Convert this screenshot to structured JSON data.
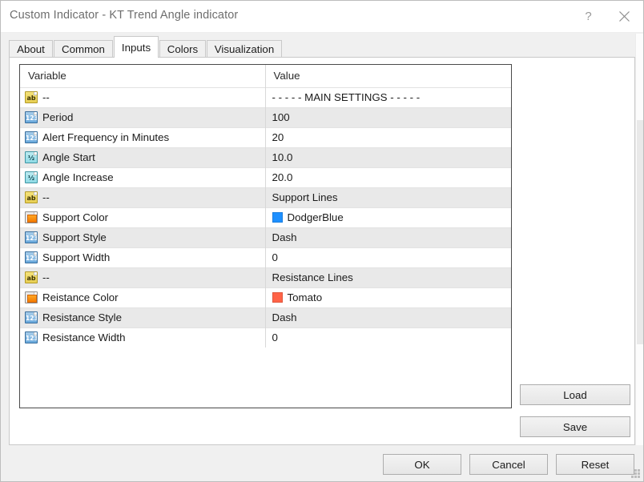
{
  "window": {
    "title": "Custom Indicator - KT Trend Angle indicator",
    "help_icon": "help-question-icon",
    "help_glyph": "?",
    "close_icon": "close-x-icon"
  },
  "tabs": [
    {
      "label": "About",
      "active": false
    },
    {
      "label": "Common",
      "active": false
    },
    {
      "label": "Inputs",
      "active": true
    },
    {
      "label": "Colors",
      "active": false
    },
    {
      "label": "Visualization",
      "active": false
    }
  ],
  "table": {
    "headers": {
      "variable": "Variable",
      "value": "Value"
    },
    "rows": [
      {
        "icon": "string-type-icon",
        "type": "str",
        "variable": "--",
        "value": "- - - - - MAIN SETTINGS - - - - -",
        "shade": "norm"
      },
      {
        "icon": "integer-type-icon",
        "type": "int",
        "variable": "Period",
        "value": "100",
        "shade": "alt"
      },
      {
        "icon": "integer-type-icon",
        "type": "int",
        "variable": "Alert Frequency in Minutes",
        "value": "20",
        "shade": "norm"
      },
      {
        "icon": "double-type-icon",
        "type": "dbl",
        "variable": "Angle Start",
        "value": "10.0",
        "shade": "alt"
      },
      {
        "icon": "double-type-icon",
        "type": "dbl",
        "variable": "Angle Increase",
        "value": "20.0",
        "shade": "norm"
      },
      {
        "icon": "string-type-icon",
        "type": "str",
        "variable": "--",
        "value": "Support Lines",
        "shade": "alt"
      },
      {
        "icon": "color-type-icon",
        "type": "col",
        "variable": "Support Color",
        "value": "DodgerBlue",
        "swatch": "#1E90FF",
        "shade": "norm"
      },
      {
        "icon": "integer-type-icon",
        "type": "int",
        "variable": "Support Style",
        "value": "Dash",
        "shade": "alt"
      },
      {
        "icon": "integer-type-icon",
        "type": "int",
        "variable": "Support Width",
        "value": "0",
        "shade": "norm"
      },
      {
        "icon": "string-type-icon",
        "type": "str",
        "variable": "--",
        "value": "Resistance Lines",
        "shade": "alt"
      },
      {
        "icon": "color-type-icon",
        "type": "col",
        "variable": "Reistance Color",
        "value": "Tomato",
        "swatch": "#FF6347",
        "shade": "norm"
      },
      {
        "icon": "integer-type-icon",
        "type": "int",
        "variable": "Resistance Style",
        "value": "Dash",
        "shade": "alt"
      },
      {
        "icon": "integer-type-icon",
        "type": "int",
        "variable": "Resistance Width",
        "value": "0",
        "shade": "norm"
      }
    ]
  },
  "side_buttons": {
    "load": "Load",
    "save": "Save"
  },
  "footer_buttons": {
    "ok": "OK",
    "cancel": "Cancel",
    "reset": "Reset"
  },
  "icon_glyphs": {
    "str": "ab",
    "int": "123",
    "dbl": "½"
  }
}
